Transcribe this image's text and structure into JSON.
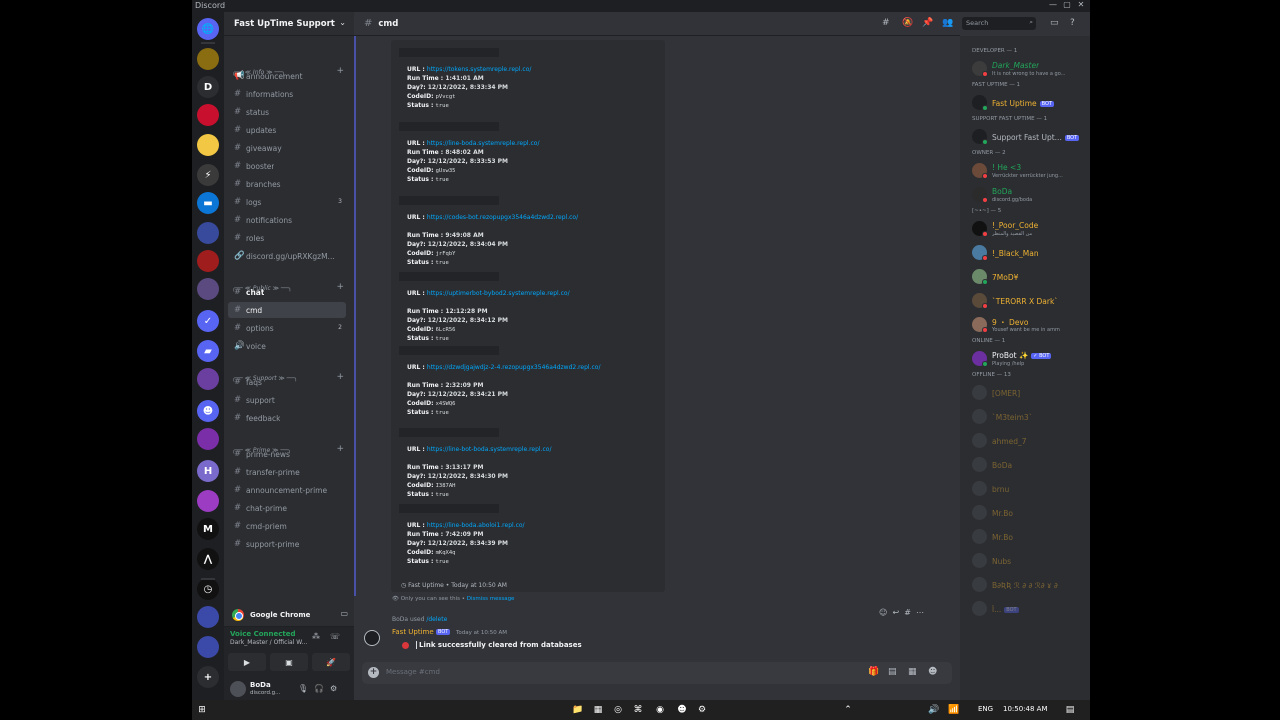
{
  "window": {
    "title": "Discord",
    "controls": [
      "—",
      "▢",
      "✕"
    ]
  },
  "servers": [
    {
      "color": "#5865f2",
      "glyph": "🌐"
    },
    {
      "color": "#8a6d10",
      "glyph": ""
    },
    {
      "color": "#2b2d31",
      "glyph": "D"
    },
    {
      "color": "#c8102e",
      "glyph": ""
    },
    {
      "color": "#f2c744",
      "glyph": ""
    },
    {
      "color": "#3a3a3a",
      "glyph": "⚡"
    },
    {
      "color": "#0b76d6",
      "glyph": "▬"
    },
    {
      "color": "#374a9c",
      "glyph": ""
    },
    {
      "color": "#a01d1d",
      "glyph": ""
    },
    {
      "color": "#5a4a80",
      "glyph": ""
    },
    {
      "color": "#5865f2",
      "glyph": "✓"
    },
    {
      "color": "#5865f2",
      "glyph": "▰"
    },
    {
      "color": "#6b3fa0",
      "glyph": ""
    },
    {
      "color": "#5865f2",
      "glyph": "☻"
    },
    {
      "color": "#7a2ea8",
      "glyph": ""
    },
    {
      "color": "#7a6acc",
      "glyph": "H"
    },
    {
      "color": "#9b3cc2",
      "glyph": ""
    },
    {
      "color": "#111111",
      "glyph": "M"
    },
    {
      "color": "#111111",
      "glyph": "⋀"
    },
    {
      "color": "#111111",
      "glyph": "◷"
    },
    {
      "color": "#3b4aa8",
      "glyph": ""
    },
    {
      "color": "#3b4aa8",
      "glyph": ""
    },
    {
      "color": "#2b2d31",
      "glyph": "+"
    }
  ],
  "guild": {
    "name": "Fast UpTime Support",
    "events_label": "Events"
  },
  "channels": [
    {
      "type": "row",
      "icon": "🗓",
      "name": "Events"
    },
    {
      "type": "cat",
      "name": "╭── ≪ Info ≫ ──╮"
    },
    {
      "type": "row",
      "icon": "📢",
      "name": "announcement"
    },
    {
      "type": "row",
      "icon": "#",
      "name": "informations"
    },
    {
      "type": "row",
      "icon": "#",
      "name": "status"
    },
    {
      "type": "row",
      "icon": "#",
      "name": "updates"
    },
    {
      "type": "row",
      "icon": "#",
      "name": "giveaway"
    },
    {
      "type": "row",
      "icon": "#",
      "name": "booster"
    },
    {
      "type": "row",
      "icon": "#",
      "name": "branches"
    },
    {
      "type": "row",
      "icon": "#",
      "name": "logs",
      "badge": "3"
    },
    {
      "type": "row",
      "icon": "#",
      "name": "notifications"
    },
    {
      "type": "row",
      "icon": "#",
      "name": "roles"
    },
    {
      "type": "row",
      "icon": "🔗",
      "name": "discord.gg/upRXKgzM..."
    },
    {
      "type": "cat",
      "name": "╭── ≪ Public ≫ ──╮"
    },
    {
      "type": "row",
      "icon": "#",
      "name": "chat",
      "unread": true
    },
    {
      "type": "row",
      "icon": "#",
      "name": "cmd",
      "active": true
    },
    {
      "type": "row",
      "icon": "#",
      "name": "options",
      "badge": "2"
    },
    {
      "type": "row",
      "icon": "🔊",
      "name": "voice"
    },
    {
      "type": "cat",
      "name": "╭── ≪ Support ≫ ──╮"
    },
    {
      "type": "row",
      "icon": "#",
      "name": "faqs"
    },
    {
      "type": "row",
      "icon": "#",
      "name": "support"
    },
    {
      "type": "row",
      "icon": "#",
      "name": "feedback"
    },
    {
      "type": "cat",
      "name": "╭── ≪ Prime ≫ ──╮"
    },
    {
      "type": "row",
      "icon": "#",
      "name": "prime-news"
    },
    {
      "type": "row",
      "icon": "#",
      "name": "transfer-prime"
    },
    {
      "type": "row",
      "icon": "#",
      "name": "announcement-prime"
    },
    {
      "type": "row",
      "icon": "#",
      "name": "chat-prime"
    },
    {
      "type": "row",
      "icon": "#",
      "name": "cmd-priem"
    },
    {
      "type": "row",
      "icon": "#",
      "name": "support-prime"
    }
  ],
  "sidebar_bottom": {
    "app_label": "Google Chrome",
    "voice_status": "Voice Connected",
    "voice_channel": "Dark_Master / Official W...",
    "user_name": "BoDa",
    "user_sub": "discord.g..."
  },
  "channel_header": {
    "name": "cmd",
    "search_placeholder": "Search"
  },
  "embed_entries": [
    {
      "url": "https://tokens.systemreple.repl.co/",
      "runtime": "1:41:01 AM",
      "day": "12/12/2022, 8:33:34 PM",
      "codeid": "pVvcgt",
      "status": "true"
    },
    {
      "url": "https://line-boda.systemreple.repl.co/",
      "runtime": "8:48:02 AM",
      "day": "12/12/2022, 8:33:53 PM",
      "codeid": "gUsw35",
      "status": "true"
    },
    {
      "url": "https://codes-bot.rezopupgx3546a4dzwd2.repl.co/",
      "runtime": "9:49:08 AM",
      "day": "12/12/2022, 8:34:04 PM",
      "codeid": "jrFqbY",
      "status": "true"
    },
    {
      "url": "https://uptimerbot-bybod2.systemreple.repl.co/",
      "runtime": "12:12:28 PM",
      "day": "12/12/2022, 8:34:12 PM",
      "codeid": "6LcR56",
      "status": "true"
    },
    {
      "url": "https://dzwdjgajwdjz-2-4.rezopupgx3546a4dzwd2.repl.co/",
      "runtime": "2:32:09 PM",
      "day": "12/12/2022, 8:34:21 PM",
      "codeid": "x4SWQ6",
      "status": "true"
    },
    {
      "url": "https://line-bot-boda.systemreple.repl.co/",
      "runtime": "3:13:17 PM",
      "day": "12/12/2022, 8:34:30 PM",
      "codeid": "I387AH",
      "status": "true"
    },
    {
      "url": "https://line-boda.aboloi1.repl.co/",
      "runtime": "7:42:09 PM",
      "day": "12/12/2022, 8:34:39 PM",
      "codeid": "mKqX4q",
      "status": "true"
    }
  ],
  "labels": {
    "url": "URL : ",
    "runtime": "Run Time : ",
    "day": "Day?: ",
    "codeid": "CodeID: ",
    "status": "Status : "
  },
  "embed_footer": "Fast Uptime • Today at 10:50 AM",
  "ephemeral": {
    "text": "Only you can see this • ",
    "dismiss": "Dismiss message"
  },
  "command_use": {
    "user": "BoDa",
    "used": " used ",
    "command": "/delete"
  },
  "bot_message": {
    "author": "Fast Uptime",
    "tag": "BOT",
    "time": "Today at 10:50 AM",
    "text": "Link successfully cleared from databases"
  },
  "composer": {
    "placeholder": "Message #cmd"
  },
  "members": [
    {
      "kind": "head",
      "text": "DEVELOPER — 1"
    },
    {
      "kind": "row",
      "name": "Dark_Master",
      "status": "It is not wrong to have a go...",
      "color": "#23a55a",
      "avatar": "#3c3c3c",
      "dot": "#f23f43",
      "italic": true
    },
    {
      "kind": "head",
      "text": "FAST UPTIME — 1"
    },
    {
      "kind": "row",
      "name": "Fast Uptime",
      "bot": "BOT",
      "color": "#f0b232",
      "avatar": "#1e1f22",
      "dot": "#23a55a"
    },
    {
      "kind": "head",
      "text": "SUPPORT FAST UPTIME — 1"
    },
    {
      "kind": "row",
      "name": "Support Fast Upt...",
      "bot": "BOT",
      "color": "#b5bac1",
      "avatar": "#1e1f22",
      "dot": "#23a55a"
    },
    {
      "kind": "head",
      "text": "OWNER — 2"
    },
    {
      "kind": "row",
      "name": "! He <3",
      "status": "Verrückter verrückter jung...",
      "color": "#23a55a",
      "avatar": "#6b4a3a",
      "dot": "#f23f43"
    },
    {
      "kind": "row",
      "name": "BoDa",
      "status": "discord.gg/boda",
      "color": "#23a55a",
      "avatar": "#2b2b2b",
      "dot": "#f23f43"
    },
    {
      "kind": "head",
      "text": "[~•~] — 5"
    },
    {
      "kind": "row",
      "name": "!_Poor_Code",
      "status": "من القصيد والمنظر",
      "color": "#f0b232",
      "avatar": "#111111",
      "dot": "#f23f43"
    },
    {
      "kind": "row",
      "name": "!_Black_Man",
      "status": "",
      "color": "#f0b232",
      "avatar": "#4a7aa0",
      "dot": "#f23f43"
    },
    {
      "kind": "row",
      "name": "7MoD¥",
      "status": "",
      "color": "#f0b232",
      "avatar": "#6a8a6a",
      "dot": "#23a55a"
    },
    {
      "kind": "row",
      "name": "`TERORR X Dark`",
      "status": "",
      "color": "#f0b232",
      "avatar": "#5a4a3a",
      "dot": "#f23f43"
    },
    {
      "kind": "row",
      "name": "9 ・ Devo",
      "status": "Yousef want be me in amm",
      "color": "#f0b232",
      "avatar": "#8a6a5a",
      "dot": "#f23f43"
    },
    {
      "kind": "head",
      "text": "ONLINE — 1"
    },
    {
      "kind": "row",
      "name": "ProBot ✨",
      "bot": "✓ BOT",
      "status": "Playing /help",
      "color": "#f2f3f5",
      "avatar": "#6b2fa0",
      "dot": "#23a55a"
    },
    {
      "kind": "head",
      "text": "OFFLINE — 13"
    },
    {
      "kind": "row",
      "name": "[OMER]",
      "color": "#f0b232",
      "avatar": "#4e5058",
      "offline": true
    },
    {
      "kind": "row",
      "name": "`M3teim3`",
      "color": "#f0b232",
      "avatar": "#4e5058",
      "offline": true
    },
    {
      "kind": "row",
      "name": "ahmed_7",
      "color": "#f0b232",
      "avatar": "#4e5058",
      "offline": true,
      "prefix": "W.F"
    },
    {
      "kind": "row",
      "name": "BoDa",
      "color": "#f0b232",
      "avatar": "#4e5058",
      "offline": true
    },
    {
      "kind": "row",
      "name": "brnu",
      "color": "#f0b232",
      "avatar": "#4e5058",
      "offline": true
    },
    {
      "kind": "row",
      "name": "Mr.Bo",
      "color": "#f0b232",
      "avatar": "#4e5058",
      "offline": true
    },
    {
      "kind": "row",
      "name": "Mr.Bo",
      "color": "#f0b232",
      "avatar": "#4e5058",
      "offline": true
    },
    {
      "kind": "row",
      "name": "Nubs",
      "color": "#f0b232",
      "avatar": "#4e5058",
      "offline": true
    },
    {
      "kind": "row",
      "name": "B∂ƦƦ ℛ ∂ ∂ ℛ∂ ɤ ∂",
      "color": "#f0b232",
      "avatar": "#4e5058",
      "offline": true
    },
    {
      "kind": "row",
      "name": "أ...",
      "bot": "BOT",
      "color": "#f0b232",
      "avatar": "#4e5058",
      "offline": true
    }
  ],
  "taskbar": {
    "lang": "ENG",
    "time": "10:50:48 AM"
  }
}
